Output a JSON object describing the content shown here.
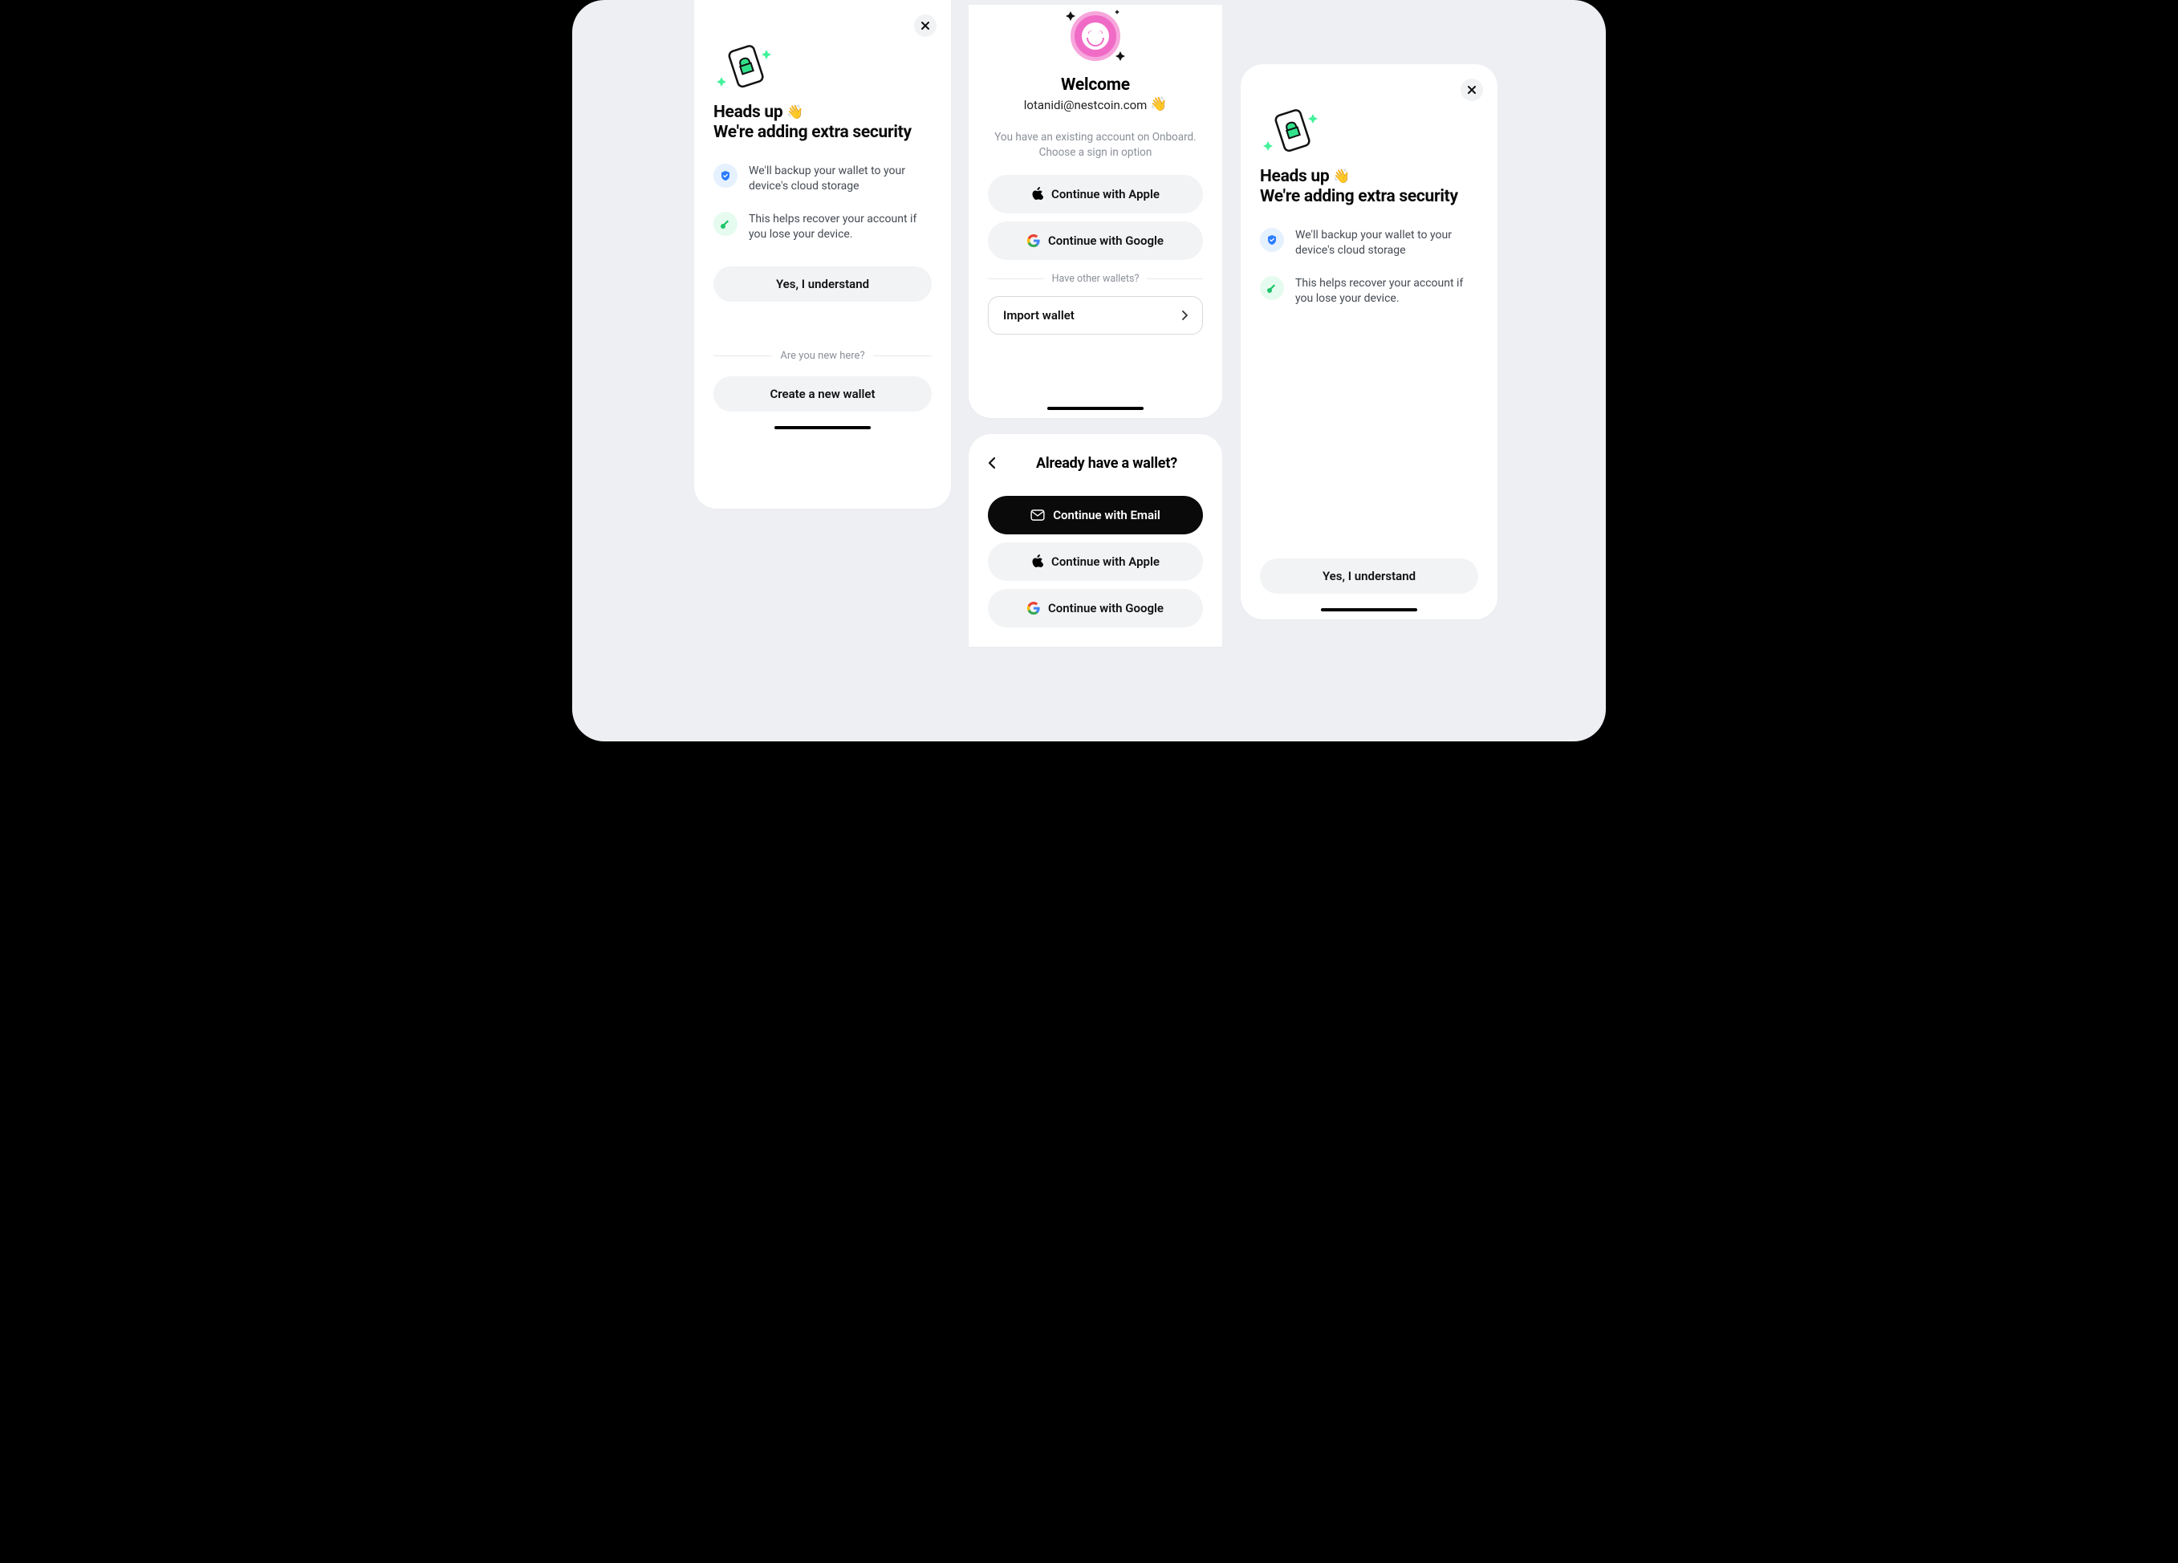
{
  "screen1": {
    "heading_line1": "Heads up ",
    "heading_line2": "We're adding extra security",
    "bullets": [
      "We'll backup your wallet to your device's cloud storage",
      "This helps recover your account if you lose your device."
    ],
    "understand": "Yes, I understand",
    "new_here": "Are you new here?",
    "create": "Create a new wallet"
  },
  "welcome": {
    "title": "Welcome",
    "email": "lotanidi@nestcoin.com ",
    "desc_line1": "You have an existing account on Onboard.",
    "desc_line2": "Choose a sign in option",
    "apple": "Continue with Apple",
    "google": "Continue with Google",
    "other": "Have other wallets?",
    "import": "Import wallet"
  },
  "already": {
    "title": "Already have a wallet?",
    "email": "Continue with Email",
    "apple": "Continue with Apple",
    "google": "Continue with Google"
  },
  "screen3": {
    "heading_line1": "Heads up ",
    "heading_line2": "We're adding extra security",
    "bullets": [
      "We'll backup your wallet to your device's cloud storage",
      "This helps recover your account if you lose your device."
    ],
    "understand": "Yes, I understand"
  }
}
